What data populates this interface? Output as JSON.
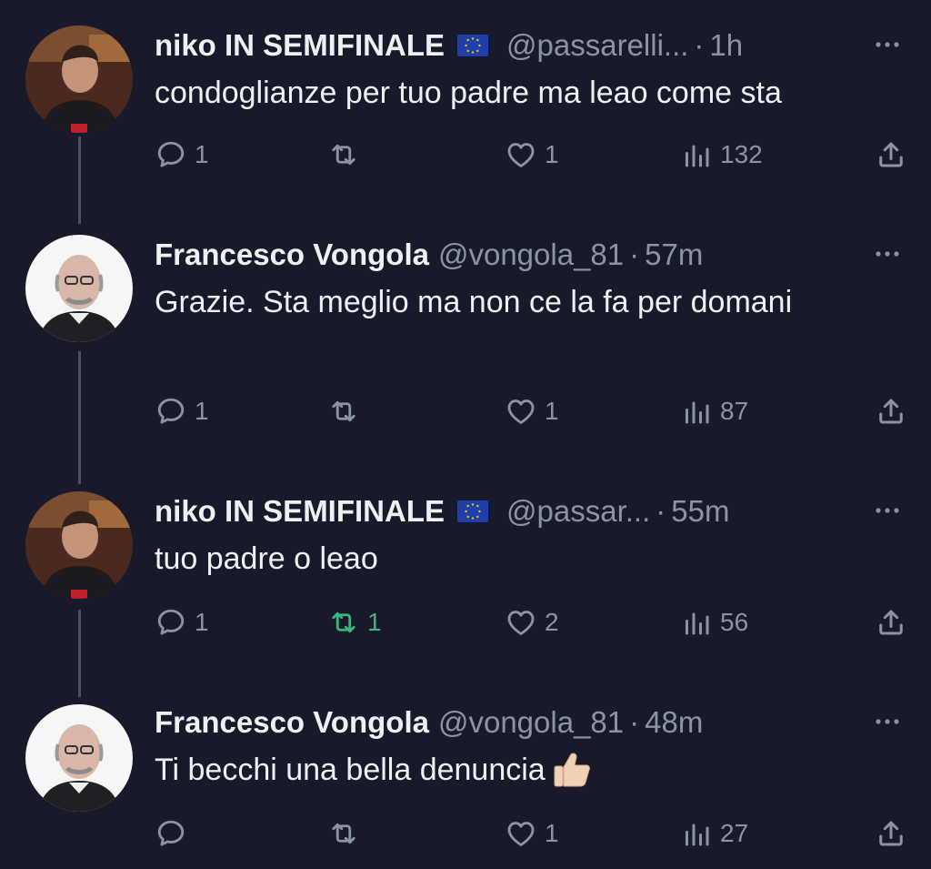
{
  "tweets": [
    {
      "name": "niko IN SEMIFINALE",
      "handle": "@passarelli...",
      "dot": "·",
      "time": "1h",
      "text": "condoglianze per tuo padre ma leao come sta",
      "replies": "1",
      "retweets": "",
      "likes": "1",
      "views": "132"
    },
    {
      "name": "Francesco Vongola",
      "handle": "@vongola_81",
      "dot": "·",
      "time": "57m",
      "text": "Grazie. Sta meglio ma non ce la fa per domani",
      "replies": "1",
      "retweets": "",
      "likes": "1",
      "views": "87"
    },
    {
      "name": "niko IN SEMIFINALE",
      "handle": "@passar...",
      "dot": "·",
      "time": "55m",
      "text": "tuo padre o leao",
      "replies": "1",
      "retweets": "1",
      "likes": "2",
      "views": "56"
    },
    {
      "name": "Francesco Vongola",
      "handle": "@vongola_81",
      "dot": "·",
      "time": "48m",
      "text": "Ti becchi una bella denuncia",
      "replies": "",
      "retweets": "",
      "likes": "1",
      "views": "27"
    }
  ],
  "colors": {
    "background": "#181a2b",
    "muted": "#8b95a1",
    "retweet_active": "#39b77a"
  },
  "icons": {
    "reply": "speech-bubble-icon",
    "retweet": "retweet-arrows-icon",
    "like": "heart-icon",
    "views": "bar-chart-icon",
    "share": "share-upload-icon",
    "more": "ellipsis-icon",
    "flag": "eu-flag-icon",
    "emoji": "thumbs-up-emoji"
  }
}
